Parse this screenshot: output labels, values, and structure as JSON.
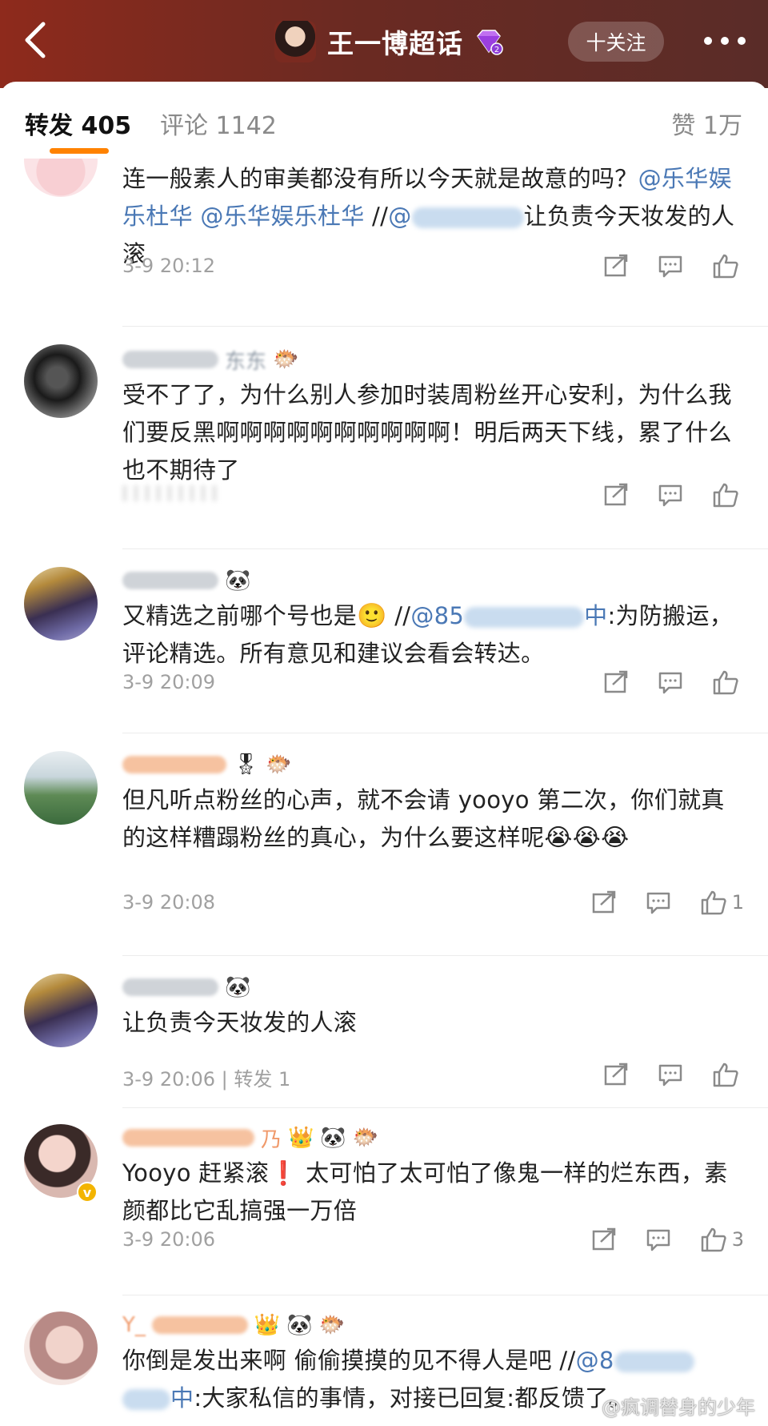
{
  "header": {
    "title": "王一博超话",
    "follow_label": "十关注",
    "back_icon": "back-arrow-icon",
    "more_icon": "more-dots-icon",
    "level_badge_icon": "purple-diamond-icon",
    "bg_color": "#7a2b20"
  },
  "tabs": {
    "repost": "转发 405",
    "comment": "评论 1142",
    "like": "赞 1万",
    "active_color": "#ff8200"
  },
  "items": [
    {
      "text_parts": [
        "连一般素人的审美都没有所以今天就是故意的吗？",
        "@乐华娱乐杜华 @乐华娱乐杜华",
        " //",
        "@",
        "让负责今天妆发的人滚"
      ],
      "time": "3-9 20:12",
      "like_count": ""
    },
    {
      "name_tail": "东东",
      "text": "受不了了，为什么别人参加时装周粉丝开心安利，为什么我们要反黑啊啊啊啊啊啊啊啊啊啊！明后两天下线，累了什么也不期待了",
      "time": "",
      "like_count": ""
    },
    {
      "text_parts": [
        "又精选之前哪个号也是",
        "🙂",
        " //",
        "@85",
        "中",
        ":为防搬运，评论精选。所有意见和建议会看会转达。"
      ],
      "time": "3-9 20:09",
      "like_count": ""
    },
    {
      "text": "但凡听点粉丝的心声，就不会请 yooyo 第二次，你们就真的这样糟蹋粉丝的真心，为什么要这样呢",
      "crying": "😭",
      "time": "3-9 20:08",
      "like_count": "1"
    },
    {
      "text": "让负责今天妆发的人滚",
      "time": "3-9 20:06 | 转发 1",
      "like_count": ""
    },
    {
      "name_tail": "乃",
      "text_parts": [
        "Yooyo 赶紧滚",
        "❗",
        " 太可怕了太可怕了像鬼一样的烂东西，素颜都比它乱搞强一万倍"
      ],
      "time": "3-9 20:06",
      "like_count": "3"
    },
    {
      "name_prefix": "Y_",
      "text_parts": [
        "你倒是发出来啊 偷偷摸摸的见不得人是吧 //",
        "@8",
        "中",
        ":大家私信的事情，对接已回复:都反馈了。"
      ]
    }
  ],
  "watermark": "@疯调替身的少年"
}
